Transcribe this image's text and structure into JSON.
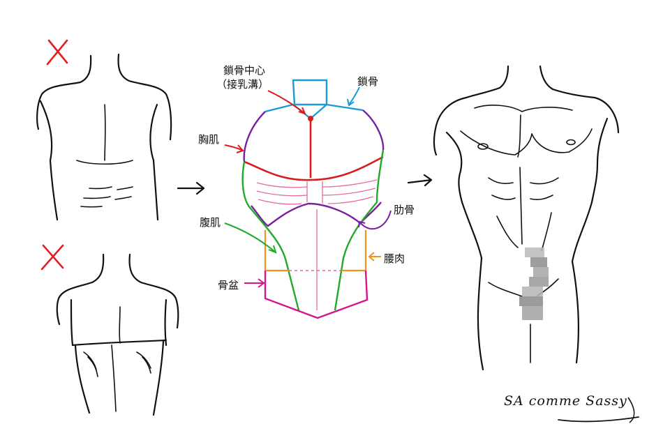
{
  "labels": {
    "clavicle_center": "鎖骨中心",
    "clavicle_center_note": "（接乳溝）",
    "clavicle": "鎖骨",
    "pectoral": "胸肌",
    "abdominal": "腹肌",
    "rib": "肋骨",
    "waist": "腰肉",
    "pelvis": "骨盆"
  },
  "signature": "SA comme Sassy",
  "wrong_marks": [
    "X",
    "X"
  ],
  "colors": {
    "ink": "#111111",
    "wrong_mark": "#e02020",
    "clavicle": "#1a9ad6",
    "red_line": "#d81c1c",
    "chest_outline": "#7a1fa0",
    "rib_lines": "#e46aa5",
    "abdominal": "#1faa2a",
    "waist": "#f0921e",
    "pelvis": "#d4148c",
    "censor": "#9a9a9a"
  }
}
